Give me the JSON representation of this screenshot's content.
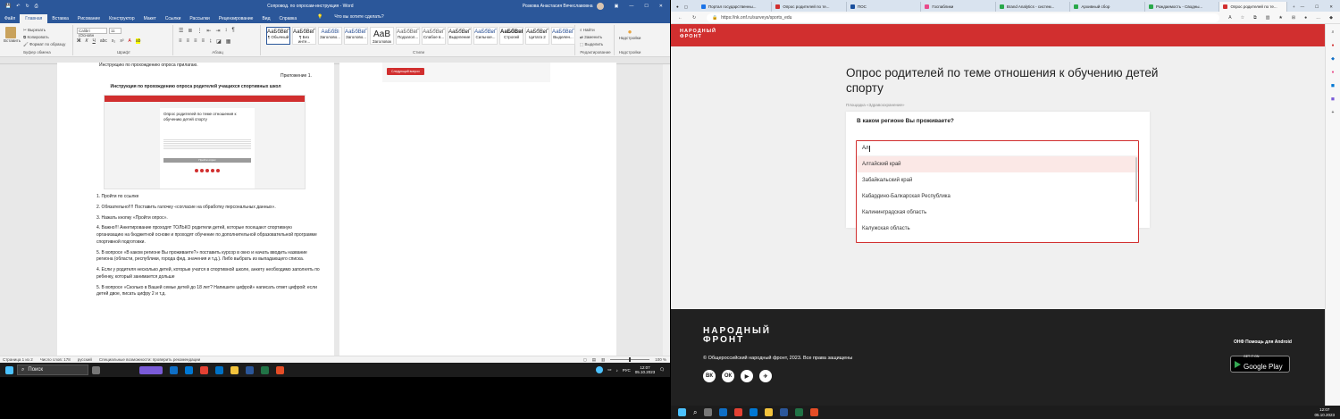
{
  "word": {
    "window_title": "Сопровод. по опросам-инструкция - Word",
    "user_name": "Розкова Анастасия Вячеславовна",
    "menu": [
      "Файл",
      "Главная",
      "Вставка",
      "Рисование",
      "Конструктор",
      "Макет",
      "Ссылки",
      "Рассылки",
      "Рецензирование",
      "Вид",
      "Справка"
    ],
    "tell_me": "Что вы хотите сделать?",
    "ribbon": {
      "clipboard": {
        "paste": "Вставить",
        "cut": "Вырезать",
        "copy": "Копировать",
        "format": "Формат по образцу",
        "label": "Буфер обмена"
      },
      "font": {
        "name": "Calibri (Основн",
        "size": "11",
        "label": "Шрифт"
      },
      "paragraph_label": "Абзац",
      "styles": [
        {
          "preview": "АаБбВвГ",
          "name": "¶ Обычный"
        },
        {
          "preview": "АаБбВвГ",
          "name": "¶ Без инте..."
        },
        {
          "preview": "АаБбВі",
          "name": "Заголово..."
        },
        {
          "preview": "АаБбВвГ",
          "name": "Заголово..."
        },
        {
          "preview": "АаВ",
          "name": "Заголовок"
        },
        {
          "preview": "АаБбВвГ",
          "name": "Подзагол..."
        },
        {
          "preview": "АаБбВвГ",
          "name": "Слабое в..."
        },
        {
          "preview": "АаБбВвГ",
          "name": "Выделение"
        },
        {
          "preview": "АаБбВвГ",
          "name": "Сильное..."
        },
        {
          "preview": "АаБбВвГ",
          "name": "Строгий"
        },
        {
          "preview": "АаБбВвГ",
          "name": "Цитата 2"
        },
        {
          "preview": "АаБбВвГ",
          "name": "Выделен..."
        }
      ],
      "styles_label": "Стили",
      "editing": {
        "find": "Найти",
        "replace": "Заменить",
        "select": "Выделить",
        "label": "Редактирование"
      },
      "addins": {
        "name": "Надстройки",
        "label": "Надстройки"
      }
    },
    "doc": {
      "top_line": "Инструкцию по прохождению опроса прилагаю.",
      "appendix": "Приложение 1.",
      "heading": "Инструкция по прохождению опроса родителей учащихся спортивных школ",
      "thumb_title": "Опрос родителей по теме отношения к обучению детей спорту",
      "thumb_button": "Пройти опрос",
      "steps": [
        "1.  Пройти по ссылке",
        "2.  Обязательно!!!! Поставить галочку «согласие на обработку персональных данных».",
        "3.  Нажать кнопку «Пройти опрос».",
        "4.  Важно!!! Анкетирование проходят ТОЛЬКО родители детей, которые посещают спортивную организацию на бюджетной основе и проходят обучение по дополнительной образовательной программе спортивной подготовки.",
        "5.  В вопросе «В каком регионе Вы проживаете?» поставить курсор в окно и начать вводить название региона (области, республики, города фед. значения и т.д.). Либо выбрать из выпадающего списка.",
        "4. Если у родителя несколько детей, которые учатся в спортивной школе, анкету необходимо заполнять по ребенку, который занимается дольше",
        "5. В вопросе «Сколько в Вашей семье детей до 18 лет? Напишите цифрой» написать ответ цифрой: если детей двое, писать цифру 2 и т.д."
      ],
      "page2_button": "Следующий вопрос"
    },
    "status": {
      "page": "Страница 1 из 2",
      "words": "Число слов: 178",
      "lang": "русский",
      "accessibility": "Специальные возможности: проверить рекомендации",
      "zoom": "100 %"
    }
  },
  "taskbar_left": {
    "search": "Поиск",
    "lang": "РУС",
    "time": "12:07",
    "date": "05.10.2023"
  },
  "browser": {
    "tabs": [
      "Портал государственны...",
      "Опрос родителей по те...",
      "ПОС",
      "Госпаблики",
      "Brand Analytics - систем...",
      "Архивный сбор",
      "Рождаемость - Сводны...",
      "Опрос родителей по те..."
    ],
    "url": "https://nk.onf.ru/surveys/sports_edu",
    "page": {
      "logo_line1": "НАРОДНЫЙ",
      "logo_line2": "ФРОНТ",
      "title": "Опрос родителей по теме отношения к обучению детей спорту",
      "breadcrumb": "Площадка «Здравоохранение»",
      "question": "В каком регионе Вы проживаете?",
      "input_value": "Ал",
      "options": [
        "Алтайский край",
        "Забайкальский край",
        "Кабардино-Балкарская Республика",
        "Калининградская область",
        "Калужская область"
      ],
      "footer_logo_line1": "НАРОДНЫЙ",
      "footer_logo_line2": "ФРОНТ",
      "copyright": "© Общероссийский народный фронт, 2023. Все права защищены",
      "social": [
        "ВК",
        "ОК",
        "▶",
        "✈"
      ],
      "android_label": "ОНФ Помощь для Android",
      "gplay_small": "GET IT ON",
      "gplay_big": "Google Play"
    },
    "taskbar": {
      "time": "12:07",
      "date": "05.10.2023"
    }
  },
  "colors": {
    "brand_red": "#d12f2f",
    "word_blue": "#2b579a",
    "footer": "#212121"
  }
}
